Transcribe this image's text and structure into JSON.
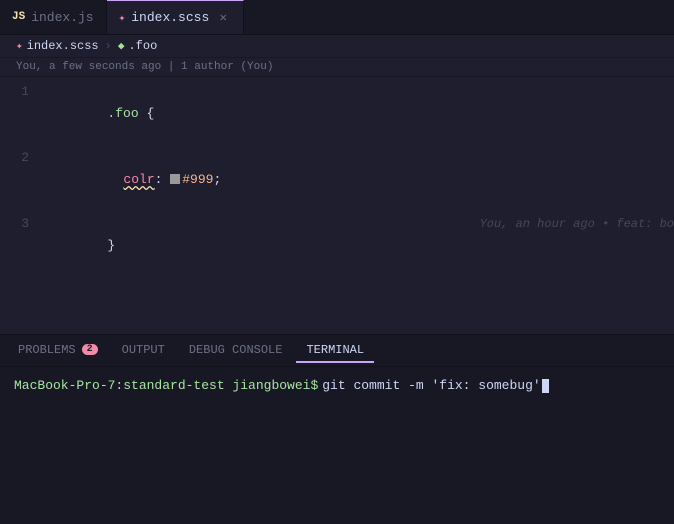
{
  "tabs": [
    {
      "id": "index-js",
      "label": "index.js",
      "icon": "js",
      "active": false,
      "modified": false
    },
    {
      "id": "index-scss",
      "label": "index.scss",
      "icon": "scss",
      "active": true,
      "modified": false
    }
  ],
  "breadcrumb": {
    "parts": [
      {
        "label": "index.scss",
        "icon": "scss"
      },
      {
        "label": ".foo",
        "icon": "class"
      }
    ]
  },
  "blame": {
    "text": "You, a few seconds ago | 1 author (You)"
  },
  "editor": {
    "lines": [
      {
        "number": "1",
        "type": "selector",
        "selector": ".foo",
        "brace": " {",
        "blame": ""
      },
      {
        "number": "2",
        "type": "property",
        "property": "colr",
        "colon": ": ",
        "color_value": "#999",
        "semicolon": ";",
        "blame": ""
      },
      {
        "number": "3",
        "type": "close",
        "brace": "}",
        "blame": "You, an hour ago • feat: bo"
      }
    ]
  },
  "panel": {
    "tabs": [
      {
        "id": "problems",
        "label": "PROBLEMS",
        "badge": "2",
        "active": false
      },
      {
        "id": "output",
        "label": "OUTPUT",
        "badge": null,
        "active": false
      },
      {
        "id": "debug-console",
        "label": "DEBUG CONSOLE",
        "badge": null,
        "active": false
      },
      {
        "id": "terminal",
        "label": "TERMINAL",
        "badge": null,
        "active": true
      }
    ],
    "terminal": {
      "prompt": "MacBook-Pro-7:standard-test jiangbowei$",
      "command": " git commit -m 'fix: somebug'"
    }
  }
}
